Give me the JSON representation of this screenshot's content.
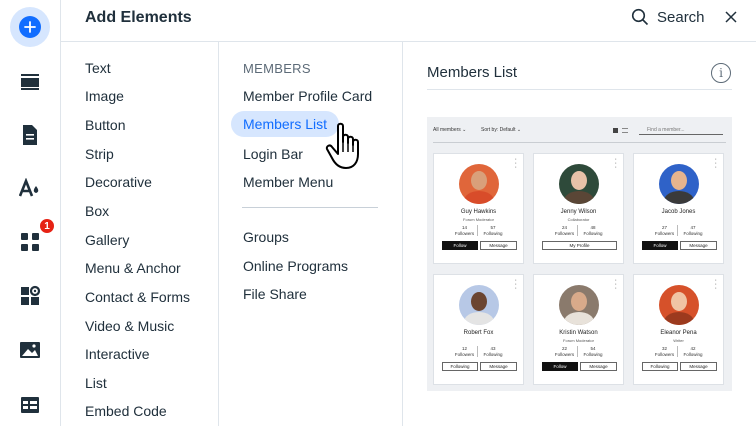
{
  "header": {
    "title": "Add Elements",
    "search_label": "Search"
  },
  "rail": {
    "badge_count": "1",
    "icons": [
      "add-icon",
      "strip-icon",
      "page-icon",
      "theme-icon",
      "apps-icon",
      "business-icon",
      "media-icon",
      "cms-icon"
    ]
  },
  "categories": [
    "Text",
    "Image",
    "Button",
    "Strip",
    "Decorative",
    "Box",
    "Gallery",
    "Menu & Anchor",
    "Contact & Forms",
    "Video & Music",
    "Interactive",
    "List",
    "Embed Code"
  ],
  "subcategories": {
    "heading": "MEMBERS",
    "group1": [
      "Member Profile Card",
      "Members List",
      "Login Bar",
      "Member Menu"
    ],
    "active": "Members List",
    "group2": [
      "Groups",
      "Online Programs",
      "File Share"
    ]
  },
  "preview": {
    "title": "Members List",
    "info_glyph": "i",
    "toolbar": {
      "filter": "All members",
      "sort": "Sort by: Default",
      "search_placeholder": "Find a member..."
    },
    "members": [
      {
        "name": "Guy Hawkins",
        "role": "Forum Moderator",
        "followers": "14",
        "following": "57",
        "followers_label": "Followers",
        "following_label": "Following",
        "primary": "Follow",
        "secondary": "Message",
        "primary_style": "solid",
        "skin": "#d9a07a",
        "bg": "#e0663a",
        "shirt": "#d84c2a"
      },
      {
        "name": "Jenny Wilson",
        "role": "Collaborator",
        "followers": "24",
        "following": "48",
        "followers_label": "Followers",
        "following_label": "Following",
        "primary": "My Profile",
        "secondary": "",
        "primary_style": "wide",
        "skin": "#e8c2a8",
        "bg": "#2e4a3a",
        "shirt": "#5a4636"
      },
      {
        "name": "Jacob Jones",
        "role": "",
        "followers": "27",
        "following": "47",
        "followers_label": "Followers",
        "following_label": "Following",
        "primary": "Follow",
        "secondary": "Message",
        "primary_style": "solid",
        "skin": "#e6b48e",
        "bg": "#2f62c8",
        "shirt": "#3a3a3a"
      },
      {
        "name": "Robert Fox",
        "role": "",
        "followers": "12",
        "following": "43",
        "followers_label": "Followers",
        "following_label": "Following",
        "primary": "Following",
        "secondary": "Message",
        "primary_style": "outline",
        "skin": "#6b4531",
        "bg": "#b7c8e6",
        "shirt": "#e4e4e4"
      },
      {
        "name": "Kristin Watson",
        "role": "Forum Moderator",
        "followers": "22",
        "following": "54",
        "followers_label": "Followers",
        "following_label": "Following",
        "primary": "Follow",
        "secondary": "Message",
        "primary_style": "solid",
        "skin": "#d8aa8a",
        "bg": "#8a7a6c",
        "shirt": "#e8e2da"
      },
      {
        "name": "Eleanor Pena",
        "role": "Writer",
        "followers": "32",
        "following": "42",
        "followers_label": "Followers",
        "following_label": "Following",
        "primary": "Following",
        "secondary": "Message",
        "primary_style": "outline",
        "skin": "#f0c4a4",
        "bg": "#d6512a",
        "shirt": "#9c3a1e"
      }
    ]
  }
}
